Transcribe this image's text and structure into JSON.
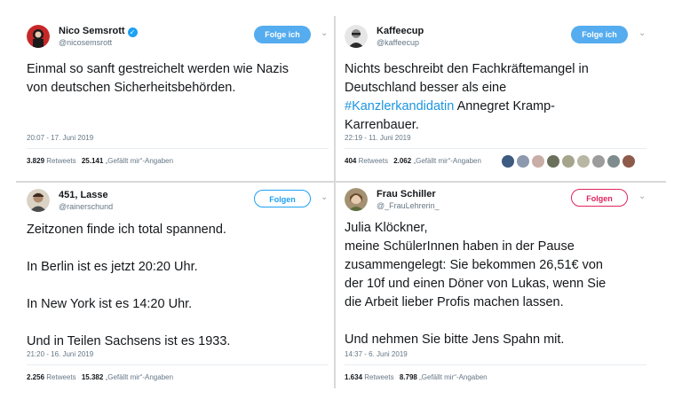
{
  "tweets": [
    {
      "name": "Nico Semsrott",
      "verified": true,
      "handle": "@nicosemsrott",
      "follow_label": "Folge ich",
      "text_lines": [
        "Einmal so sanft gestreichelt werden wie Nazis",
        "von deutschen Sicherheitsbehörden."
      ],
      "timestamp": "20:07 - 17. Juni 2019",
      "retweets": "3.829",
      "retweets_label": "Retweets",
      "likes": "25.141",
      "likes_label": "„Gefällt mir“-Angaben"
    },
    {
      "name": "Kaffeecup",
      "handle": "@kaffeecup",
      "follow_label": "Folge ich",
      "text_lines": [
        "Nichts beschreibt den Fachkräftemangel in",
        "Deutschland besser als eine"
      ],
      "hashtag": "#Kanzlerkandidatin",
      "text_after_hashtag": " Annegret Kramp-",
      "text_last": "Karrenbauer.",
      "timestamp": "22:19 - 11. Juni 2019",
      "retweets": "404",
      "retweets_label": "Retweets",
      "likes": "2.062",
      "likes_label": "„Gefällt mir“-Angaben"
    },
    {
      "name": "451, Lasse",
      "handle": "@rainerschund",
      "follow_label": "Folgen",
      "text_lines": [
        "Zeitzonen finde ich total spannend.",
        "",
        "In Berlin ist es jetzt 20:20 Uhr.",
        "",
        "In New York ist es 14:20 Uhr.",
        "",
        "Und in Teilen Sachsens ist es 1933."
      ],
      "timestamp": "21:20 - 16. Juni 2019",
      "retweets": "2.256",
      "retweets_label": "Retweets",
      "likes": "15.382",
      "likes_label": "„Gefällt mir“-Angaben"
    },
    {
      "name": "Frau Schiller",
      "handle": "@_FrauLehrerin_",
      "follow_label": "Folgen",
      "text_lines": [
        "Julia Klöckner,",
        "meine SchülerInnen haben in der Pause",
        "zusammengelegt: Sie bekommen 26,51€ von",
        "der 10f und einen Döner von Lukas, wenn Sie",
        "die Arbeit lieber Profis machen lassen.",
        "",
        "Und nehmen Sie bitte Jens Spahn mit."
      ],
      "timestamp": "14:37 - 6. Juni 2019",
      "retweets": "1.634",
      "retweets_label": "Retweets",
      "likes": "8.798",
      "likes_label": "„Gefällt mir“-Angaben"
    }
  ],
  "icons": {
    "verified": "verified-badge-icon",
    "more": "chevron-down-icon"
  },
  "colors": {
    "follow_blue": "#55acee",
    "follow_outline_blue": "#1da1f2",
    "follow_outline_red": "#e0245e",
    "hashtag": "#1b95e0"
  }
}
